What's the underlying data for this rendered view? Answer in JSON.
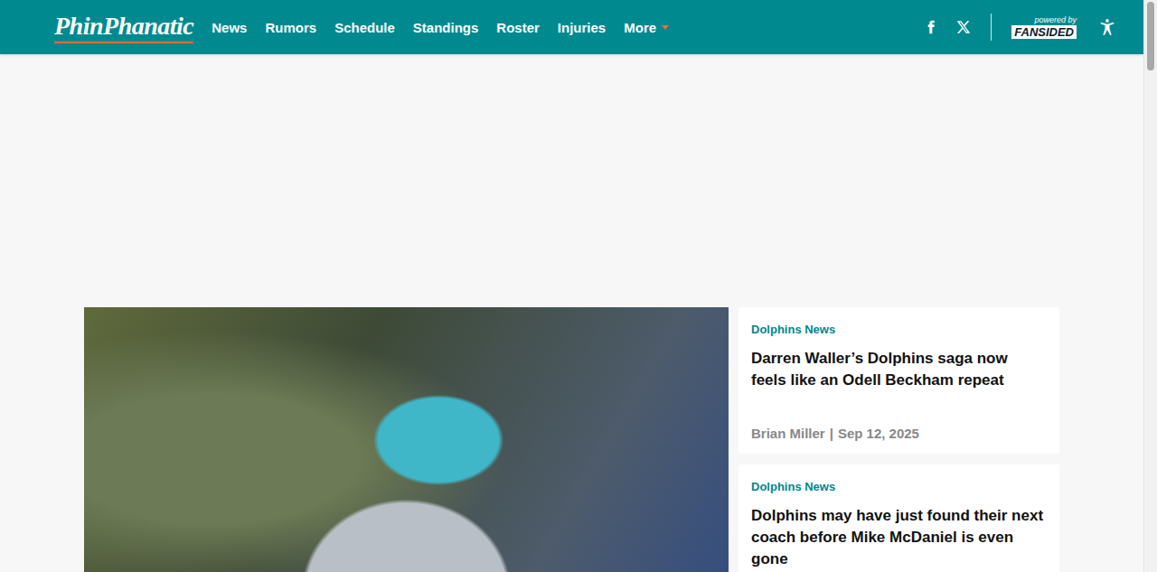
{
  "site": {
    "logo": "PhinPhanatic"
  },
  "nav": {
    "items": [
      {
        "label": "News",
        "dropdown": false
      },
      {
        "label": "Rumors",
        "dropdown": false
      },
      {
        "label": "Schedule",
        "dropdown": false
      },
      {
        "label": "Standings",
        "dropdown": false
      },
      {
        "label": "Roster",
        "dropdown": false
      },
      {
        "label": "Injuries",
        "dropdown": false
      },
      {
        "label": "More",
        "dropdown": true
      }
    ]
  },
  "header_right": {
    "powered_by": "powered by",
    "brand": "FANSIDED"
  },
  "hero": {
    "kind": "photo"
  },
  "articles": [
    {
      "category": "Dolphins News",
      "title": "Darren Waller’s Dolphins saga now feels like an Odell Beckham repeat",
      "author": "Brian Miller",
      "separator": "|",
      "date": "Sep 12, 2025"
    },
    {
      "category": "Dolphins News",
      "title": "Dolphins may have just found their next coach before Mike McDaniel is even gone",
      "author": "",
      "separator": "",
      "date": ""
    }
  ]
}
